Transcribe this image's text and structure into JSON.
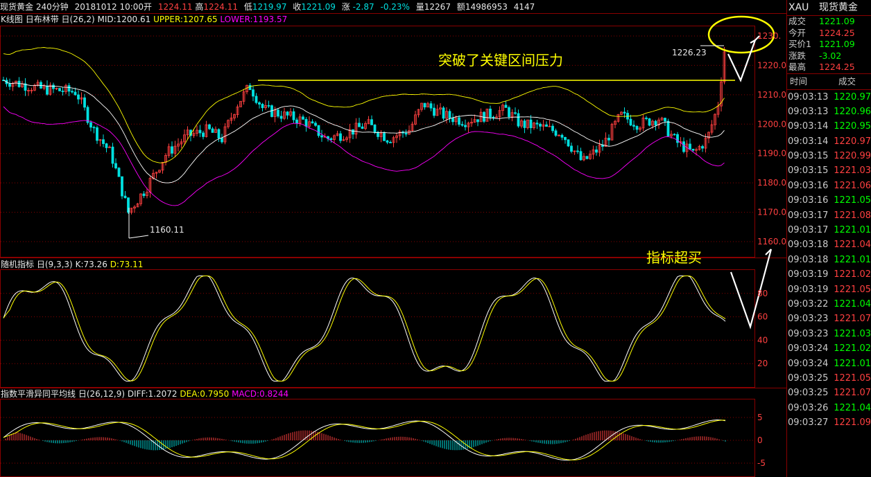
{
  "header": {
    "title": "现货黄金 240分钟",
    "date": "20181012 10:00",
    "open_label": "开",
    "open": "1224.11",
    "high_label": "高",
    "high": "1224.11",
    "low_label": "低",
    "low": "1219.97",
    "close_label": "收",
    "close": "1221.09",
    "change_label": "涨",
    "change": "-2.87",
    "change_pct": "-0.23%",
    "volume_label": "量",
    "volume": "12267",
    "amount_label": "额",
    "amount": "14986953",
    "extra": "4147"
  },
  "main_panel": {
    "name": "K线图",
    "indicator": "日布林带",
    "params": "日(26,2)",
    "mid_label": "MID:",
    "mid": "1200.61",
    "upper_label": "UPPER:",
    "upper": "1207.65",
    "lower_label": "LOWER:",
    "lower": "1193.57",
    "annotation_breakout": "突破了关键区间压力",
    "price_high_label": "1226.23",
    "price_low_label": "1160.11",
    "y_ticks": [
      "1230.",
      "1220.0",
      "1210.0",
      "1200.0",
      "1190.0",
      "1180.0",
      "1170.0",
      "1160.0"
    ]
  },
  "kdj_panel": {
    "name": "随机指标",
    "params": "日(9,3,3)",
    "k_label": "K:",
    "k": "73.26",
    "d_label": "D:",
    "d": "73.11",
    "annotation": "指标超买",
    "y_ticks": [
      "80",
      "60",
      "40",
      "20"
    ]
  },
  "macd_panel": {
    "name": "指数平滑异同平均线",
    "params": "日(26,12,9)",
    "diff_label": "DIFF:",
    "diff": "1.2072",
    "dea_label": "DEA:",
    "dea": "0.7950",
    "macd_label": "MACD:",
    "macd": "0.8244",
    "y_ticks": [
      "5",
      "0",
      "-5"
    ]
  },
  "quote": {
    "symbol": "XAU",
    "name": "现货黄金",
    "rows": [
      {
        "label": "成交",
        "value": "1221.09",
        "color": "green"
      },
      {
        "label": "今开",
        "value": "1224.25",
        "color": "red"
      },
      {
        "label": "买价1",
        "value": "1221.09",
        "color": "green"
      },
      {
        "label": "涨跌",
        "value": "-3.02",
        "color": "green"
      },
      {
        "label": "最高",
        "value": "1224.25",
        "color": "red"
      }
    ],
    "ticks_header": {
      "time": "时间",
      "price": "成交"
    },
    "ticks": [
      {
        "time": "09:03:13",
        "price": "1220.97",
        "color": "green"
      },
      {
        "time": "09:03:13",
        "price": "1220.96",
        "color": "green"
      },
      {
        "time": "09:03:14",
        "price": "1220.95",
        "color": "green"
      },
      {
        "time": "09:03:14",
        "price": "1220.97",
        "color": "red"
      },
      {
        "time": "09:03:15",
        "price": "1220.99",
        "color": "red"
      },
      {
        "time": "09:03:15",
        "price": "1221.03",
        "color": "red"
      },
      {
        "time": "09:03:16",
        "price": "1221.06",
        "color": "red"
      },
      {
        "time": "09:03:16",
        "price": "1221.05",
        "color": "green"
      },
      {
        "time": "09:03:17",
        "price": "1221.08",
        "color": "red"
      },
      {
        "time": "09:03:17",
        "price": "1221.01",
        "color": "green"
      },
      {
        "time": "09:03:18",
        "price": "1221.04",
        "color": "red"
      },
      {
        "time": "09:03:18",
        "price": "1221.01",
        "color": "green"
      },
      {
        "time": "09:03:19",
        "price": "1221.02",
        "color": "red"
      },
      {
        "time": "09:03:19",
        "price": "1221.05",
        "color": "red"
      },
      {
        "time": "09:03:22",
        "price": "1221.04",
        "color": "green"
      },
      {
        "time": "09:03:23",
        "price": "1221.07",
        "color": "red"
      },
      {
        "time": "09:03:23",
        "price": "1221.03",
        "color": "green"
      },
      {
        "time": "09:03:24",
        "price": "1221.02",
        "color": "green"
      },
      {
        "time": "09:03:24",
        "price": "1221.01",
        "color": "green"
      },
      {
        "time": "09:03:25",
        "price": "1221.05",
        "color": "red"
      },
      {
        "time": "09:03:25",
        "price": "1221.07",
        "color": "red"
      },
      {
        "time": "09:03:26",
        "price": "1221.04",
        "color": "green"
      },
      {
        "time": "09:03:27",
        "price": "1221.09",
        "color": "red"
      }
    ]
  },
  "colors": {
    "up": "#ff4040",
    "down": "#00e0e0",
    "upper_band": "#ffff00",
    "mid_band": "#ffffff",
    "lower_band": "#ff00ff",
    "grid": "#8a0000",
    "annotation": "#ffff00"
  }
}
